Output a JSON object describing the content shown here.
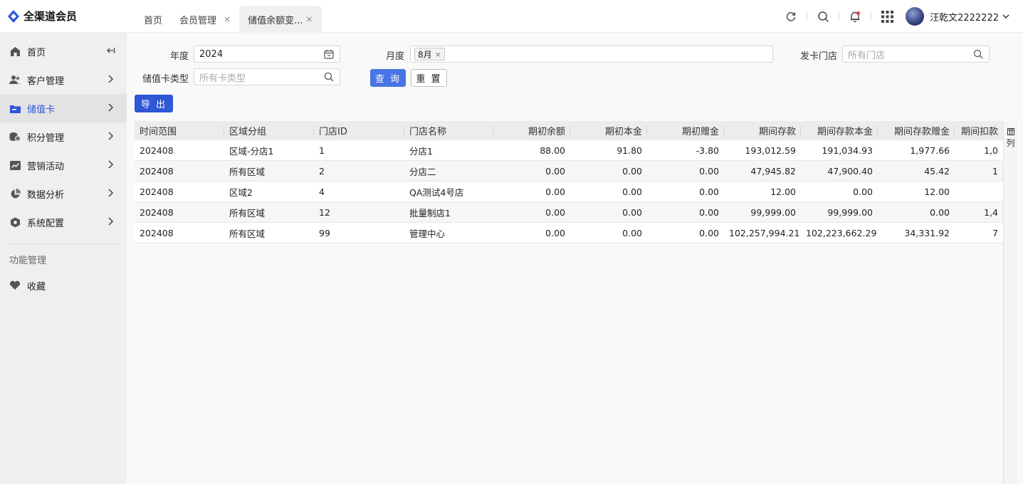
{
  "header": {
    "app_title": "全渠道会员",
    "tabs": [
      {
        "label": "首页",
        "closable": false
      },
      {
        "label": "会员管理",
        "closable": true
      },
      {
        "label": "储值余额变...",
        "closable": true,
        "active": true
      }
    ],
    "close_glyph": "×",
    "user_name": "汪乾文2222222",
    "accent_color": "#2d55d9"
  },
  "sidebar": {
    "items": [
      {
        "label": "首页",
        "icon": "home-icon"
      },
      {
        "label": "客户管理",
        "icon": "users-icon"
      },
      {
        "label": "储值卡",
        "icon": "card-icon",
        "active": true
      },
      {
        "label": "积分管理",
        "icon": "coins-icon"
      },
      {
        "label": "营销活动",
        "icon": "chart-trend-icon"
      },
      {
        "label": "数据分析",
        "icon": "pie-chart-icon"
      },
      {
        "label": "系统配置",
        "icon": "hexagon-settings-icon"
      }
    ],
    "section_title": "功能管理",
    "favorites_label": "收藏"
  },
  "filters": {
    "year_label": "年度",
    "year_value": "2024",
    "month_label": "月度",
    "month_tag": "8月",
    "store_label": "发卡门店",
    "store_placeholder": "所有门店",
    "card_type_label": "储值卡类型",
    "card_type_placeholder": "所有卡类型",
    "query_button": "查 询",
    "reset_button": "重 置",
    "export_button": "导 出"
  },
  "table": {
    "columns": [
      "时间范围",
      "区域分组",
      "门店ID",
      "门店名称",
      "期初余额",
      "期初本金",
      "期初赠金",
      "期间存款",
      "期间存款本金",
      "期间存款赠金",
      "期间扣款"
    ],
    "rows": [
      [
        "202408",
        "区域-分店1",
        "1",
        "分店1",
        "88.00",
        "91.80",
        "-3.80",
        "193,012.59",
        "191,034.93",
        "1,977.66",
        "1,0"
      ],
      [
        "202408",
        "所有区域",
        "2",
        "分店二",
        "0.00",
        "0.00",
        "0.00",
        "47,945.82",
        "47,900.40",
        "45.42",
        "1"
      ],
      [
        "202408",
        "区域2",
        "4",
        "QA测试4号店",
        "0.00",
        "0.00",
        "0.00",
        "12.00",
        "0.00",
        "12.00",
        ""
      ],
      [
        "202408",
        "所有区域",
        "12",
        "批量制店1",
        "0.00",
        "0.00",
        "0.00",
        "99,999.00",
        "99,999.00",
        "0.00",
        "1,4"
      ],
      [
        "202408",
        "所有区域",
        "99",
        "管理中心",
        "0.00",
        "0.00",
        "0.00",
        "102,257,994.21",
        "102,223,662.29",
        "34,331.92",
        "7"
      ]
    ],
    "column_settings_label": "列"
  }
}
